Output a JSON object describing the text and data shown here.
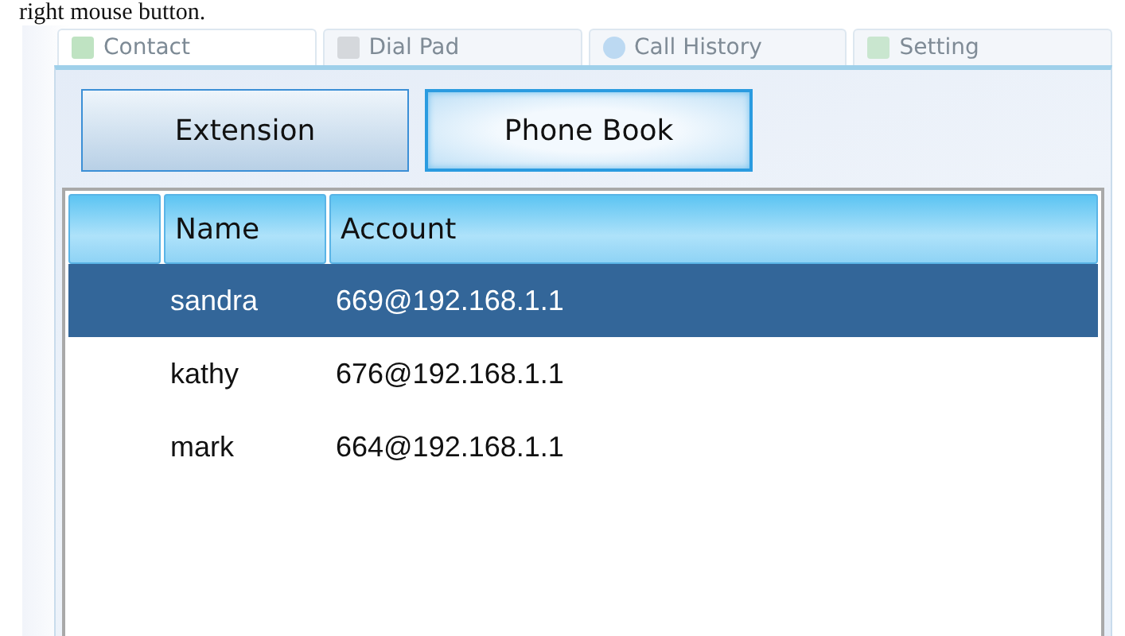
{
  "caption": "right mouse button.",
  "tabs": [
    {
      "label": "Contact",
      "selected": true
    },
    {
      "label": "Dial Pad",
      "selected": false
    },
    {
      "label": "Call History",
      "selected": false
    },
    {
      "label": "Setting",
      "selected": false
    }
  ],
  "buttons": [
    {
      "label": "Extension",
      "selected": false
    },
    {
      "label": "Phone Book",
      "selected": true
    }
  ],
  "table": {
    "columns": [
      "Name",
      "Account"
    ],
    "rows": [
      {
        "name": "sandra",
        "account": "669@192.168.1.1",
        "selected": true
      },
      {
        "name": "kathy",
        "account": "676@192.168.1.1",
        "selected": false
      },
      {
        "name": "mark",
        "account": "664@192.168.1.1",
        "selected": false
      }
    ]
  }
}
